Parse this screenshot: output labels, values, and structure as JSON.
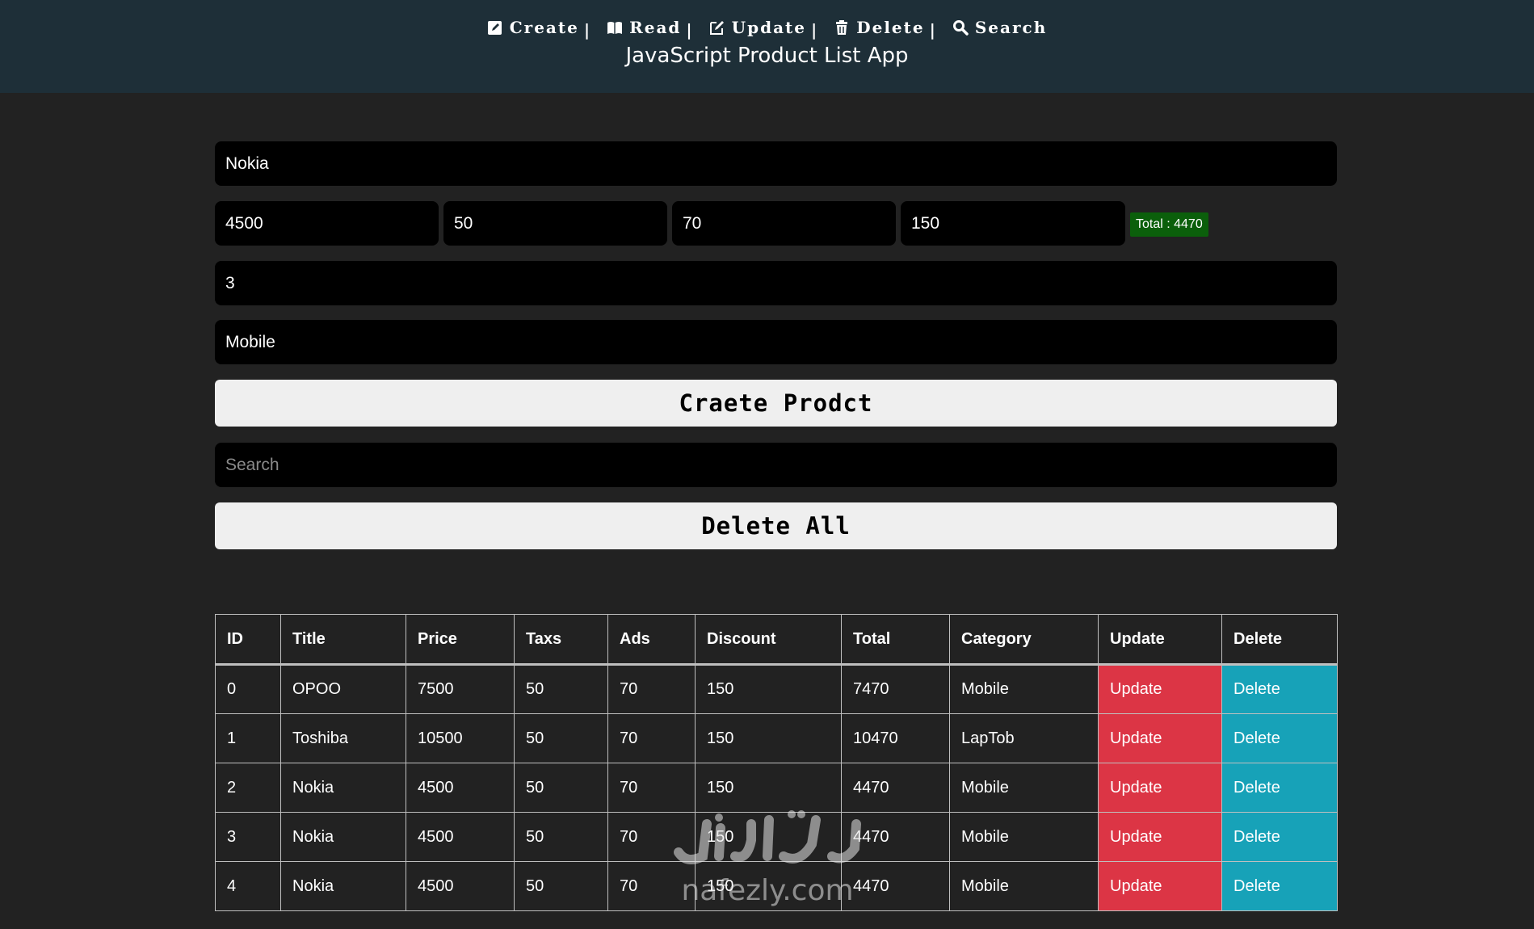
{
  "header": {
    "nav": [
      {
        "label": "Create",
        "icon": "edit-square-icon"
      },
      {
        "label": "Read",
        "icon": "book-icon"
      },
      {
        "label": "Update",
        "icon": "pencil-square-icon"
      },
      {
        "label": "Delete",
        "icon": "trash-icon"
      },
      {
        "label": "Search",
        "icon": "search-icon"
      }
    ],
    "separator": "|",
    "title": "JavaScript Product List App"
  },
  "form": {
    "title_value": "Nokia",
    "price_value": "4500",
    "taxes_value": "50",
    "ads_value": "70",
    "discount_value": "150",
    "total_label": "Total : 4470",
    "count_value": "3",
    "category_value": "Mobile",
    "create_button": "Craete Prodct",
    "search_placeholder": "Search",
    "delete_all_button": "Delete All"
  },
  "table": {
    "headers": [
      "ID",
      "Title",
      "Price",
      "Taxs",
      "Ads",
      "Discount",
      "Total",
      "Category",
      "Update",
      "Delete"
    ],
    "rows": [
      {
        "id": "0",
        "title": "OPOO",
        "price": "7500",
        "taxes": "50",
        "ads": "70",
        "discount": "150",
        "total": "7470",
        "category": "Mobile",
        "update": "Update",
        "delete": "Delete"
      },
      {
        "id": "1",
        "title": "Toshiba",
        "price": "10500",
        "taxes": "50",
        "ads": "70",
        "discount": "150",
        "total": "10470",
        "category": "LapTob",
        "update": "Update",
        "delete": "Delete"
      },
      {
        "id": "2",
        "title": "Nokia",
        "price": "4500",
        "taxes": "50",
        "ads": "70",
        "discount": "150",
        "total": "4470",
        "category": "Mobile",
        "update": "Update",
        "delete": "Delete"
      },
      {
        "id": "3",
        "title": "Nokia",
        "price": "4500",
        "taxes": "50",
        "ads": "70",
        "discount": "150",
        "total": "4470",
        "category": "Mobile",
        "update": "Update",
        "delete": "Delete"
      },
      {
        "id": "4",
        "title": "Nokia",
        "price": "4500",
        "taxes": "50",
        "ads": "70",
        "discount": "150",
        "total": "4470",
        "category": "Mobile",
        "update": "Update",
        "delete": "Delete"
      }
    ]
  },
  "watermark": {
    "logo_text": "نفذلي",
    "url": "nafezly.com"
  },
  "colors": {
    "header_bg": "#1e2f38",
    "page_bg": "#222222",
    "input_bg": "#000000",
    "total_badge_bg": "#0b5f0b",
    "update_bg": "#dc3545",
    "delete_bg": "#17a2b8",
    "button_bg": "#efefef"
  }
}
